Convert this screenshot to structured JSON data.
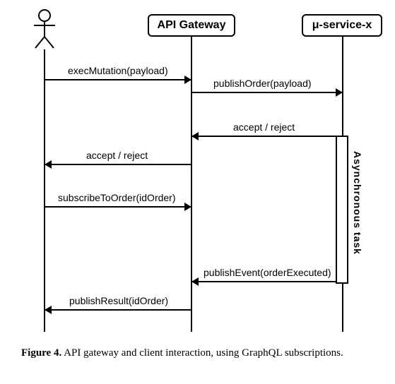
{
  "participants": {
    "actor_label": "",
    "gateway": "API Gateway",
    "service": "μ-service-x"
  },
  "messages": {
    "m1": "execMutation(payload)",
    "m2": "publishOrder(payload)",
    "m3": "accept / reject",
    "m4": "accept / reject",
    "m5": "subscribeToOrder(idOrder)",
    "m6": "publishEvent(orderExecuted)",
    "m7": "publishResult(idOrder)"
  },
  "activation": {
    "label": "Asynchronous task"
  },
  "caption": {
    "lead": "Figure 4.",
    "text": " API gateway and client interaction, using GraphQL subscriptions."
  },
  "chart_data": {
    "type": "sequence-diagram",
    "participants": [
      {
        "id": "client",
        "kind": "actor",
        "label": ""
      },
      {
        "id": "gateway",
        "kind": "component",
        "label": "API Gateway"
      },
      {
        "id": "service",
        "kind": "component",
        "label": "μ-service-x"
      }
    ],
    "messages": [
      {
        "from": "client",
        "to": "gateway",
        "label": "execMutation(payload)",
        "direction": "request"
      },
      {
        "from": "gateway",
        "to": "service",
        "label": "publishOrder(payload)",
        "direction": "request"
      },
      {
        "from": "service",
        "to": "gateway",
        "label": "accept / reject",
        "direction": "response"
      },
      {
        "from": "gateway",
        "to": "client",
        "label": "accept / reject",
        "direction": "response"
      },
      {
        "from": "client",
        "to": "gateway",
        "label": "subscribeToOrder(idOrder)",
        "direction": "request"
      },
      {
        "from": "service",
        "to": "gateway",
        "label": "publishEvent(orderExecuted)",
        "direction": "response"
      },
      {
        "from": "gateway",
        "to": "client",
        "label": "publishResult(idOrder)",
        "direction": "response"
      }
    ],
    "activations": [
      {
        "participant": "service",
        "label": "Asynchronous task",
        "spans": [
          "accept / reject",
          "publishEvent(orderExecuted)"
        ]
      }
    ]
  }
}
